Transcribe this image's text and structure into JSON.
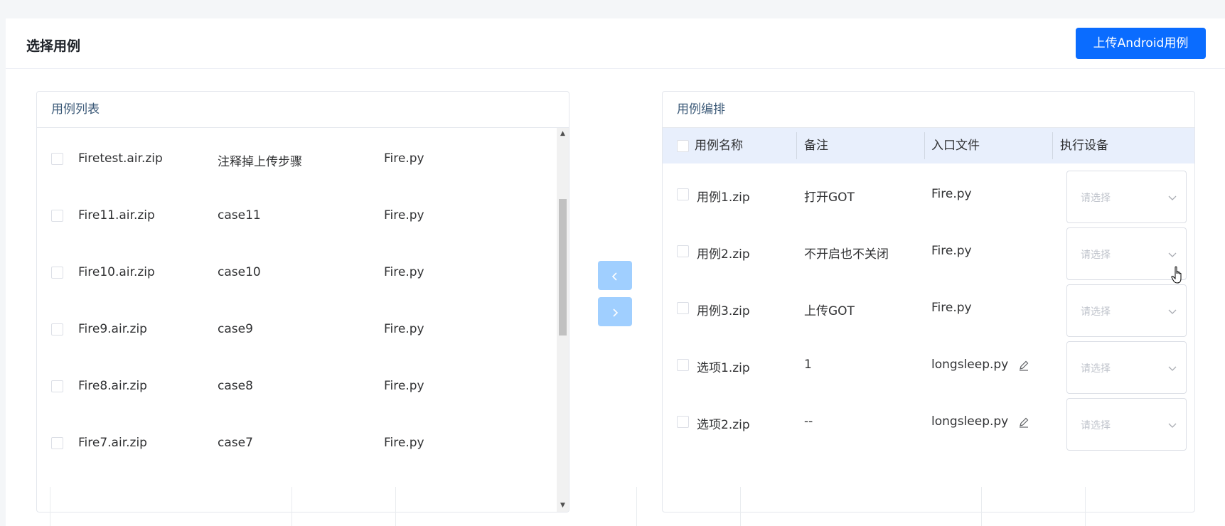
{
  "header": {
    "title": "选择用例",
    "upload_button": "上传Android用例"
  },
  "case_list": {
    "title": "用例列表",
    "rows": [
      {
        "name": "Firetest.air.zip",
        "note": "注释掉上传步骤",
        "entry": "Fire.py"
      },
      {
        "name": "Fire11.air.zip",
        "note": "case11",
        "entry": "Fire.py"
      },
      {
        "name": "Fire10.air.zip",
        "note": "case10",
        "entry": "Fire.py"
      },
      {
        "name": "Fire9.air.zip",
        "note": "case9",
        "entry": "Fire.py"
      },
      {
        "name": "Fire8.air.zip",
        "note": "case8",
        "entry": "Fire.py"
      },
      {
        "name": "Fire7.air.zip",
        "note": "case7",
        "entry": "Fire.py"
      }
    ]
  },
  "transfer": {
    "left_icon": "chevron-left-icon",
    "right_icon": "chevron-right-icon"
  },
  "arrangement": {
    "title": "用例编排",
    "columns": [
      "用例名称",
      "备注",
      "入口文件",
      "执行设备"
    ],
    "rows": [
      {
        "name": "用例1.zip",
        "note": "打开GOT",
        "entry": "Fire.py",
        "device_placeholder": "请选择"
      },
      {
        "name": "用例2.zip",
        "note": "不开启也不关闭",
        "entry": "Fire.py",
        "device_placeholder": "请选择"
      },
      {
        "name": "用例3.zip",
        "note": "上传GOT",
        "entry": "Fire.py",
        "device_placeholder": "请选择"
      },
      {
        "name": "选项1.zip",
        "note": "1",
        "entry": "longsleep.py",
        "editable": true,
        "device_placeholder": "请选择"
      },
      {
        "name": "选项2.zip",
        "note": "--",
        "entry": "longsleep.py",
        "editable": true,
        "device_placeholder": "请选择"
      }
    ]
  },
  "colors": {
    "primary": "#0a6cff",
    "transfer_disabled": "#a0cfff",
    "table_header_bg": "#e8effc",
    "panel_title": "#3c5a78"
  }
}
